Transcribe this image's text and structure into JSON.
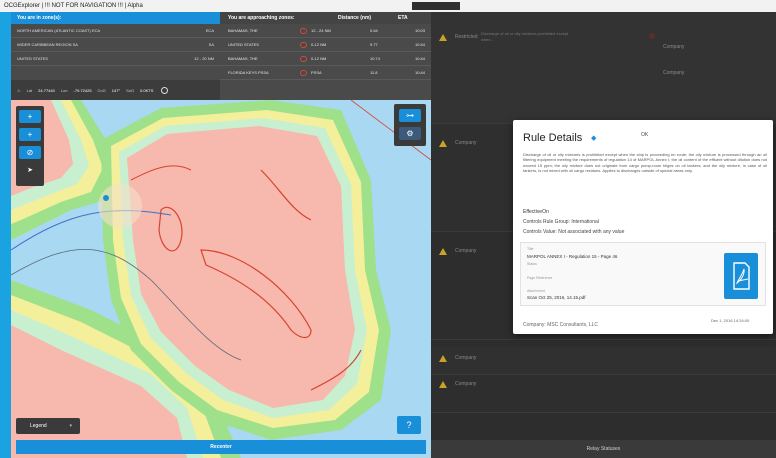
{
  "window": {
    "title": "OCGExplorer | !!! NOT FOR NAVIGATION !!! | Alpha"
  },
  "zones": {
    "header": "You are in zone(s):",
    "rows": [
      {
        "name": "NORTH AMERICAN (ATLANTIC COAST) ECA",
        "value": "ECA"
      },
      {
        "name": "WIDER CARIBBEAN REGION SA",
        "value": "SA"
      },
      {
        "name": "UNITED STATES",
        "value": "12 - 20 NM"
      }
    ]
  },
  "position_bar": {
    "lat_label": "Lat",
    "lat_value": "24.77440",
    "lon_label": "Lon",
    "lon_value": "-79.72425",
    "cog_label": "CoG",
    "cog_value": "147°",
    "sog_label": "SoG",
    "sog_value": "0.0KTS"
  },
  "approach": {
    "headers": [
      "You are approaching zones:",
      "",
      "Distance (nm)",
      "ETA"
    ],
    "rows": [
      {
        "name": "BAHAMAS, THE",
        "range": "12 - 24 NM",
        "distance": "0.64",
        "eta": "10:03"
      },
      {
        "name": "UNITED STATES",
        "range": "0-12 NM",
        "distance": "9.77",
        "eta": "10:44"
      },
      {
        "name": "BAHAMAS, THE",
        "range": "0-12 NM",
        "distance": "10.74",
        "eta": "10:44"
      },
      {
        "name": "FLORIDA KEYS PSSA",
        "range": "PSSA",
        "distance": "11.8",
        "eta": "10:44"
      }
    ]
  },
  "map_controls": {
    "zoom_in": "+",
    "zoom_out": "+",
    "compass": "⊘",
    "pointer": "➤",
    "legend_label": "Legend",
    "help_label": "?",
    "recenter_label": "Recenter"
  },
  "right_list": [
    {
      "label": "Restricted",
      "desc": "Discharge of oil or oily mixtures prohibited except when...",
      "company": "Company"
    },
    {
      "label": "",
      "desc": "",
      "company": "Company"
    },
    {
      "label": "Company",
      "desc": "",
      "company": ""
    },
    {
      "label": "Company",
      "desc": "",
      "company": ""
    },
    {
      "label": "Company",
      "desc": "",
      "company": ""
    },
    {
      "label": "Company",
      "desc": "",
      "company": ""
    }
  ],
  "relay": {
    "label": "Relay Statuses"
  },
  "rule": {
    "title": "Rule Details",
    "ok": "OK",
    "description": "Discharge of oil or oily mixtures is prohibited except when the ship is proceeding en route; the oily mixture is processed through an oil filtering equipment meeting the requirements of regulation 14 of MARPOL Annex I; the oil content of the effluent without dilution does not exceed 15 ppm; the oily mixture does not originate from cargo pump-room bilges on oil tankers; and the oily mixture, in case of oil tankers, is not mixed with oil cargo residues. Applies to discharges outside of special areas only.",
    "effective_on": "EffectiveOn",
    "group": "Controls Rule Group: International",
    "value": "Controls Value: Not associated with any value",
    "doc_title_label": "Title",
    "doc_title": "MARPOL ANNEX I - Regulation 15 - Page 46",
    "doc_status_label": "Status",
    "doc_page_label": "Page Reference",
    "doc_file_label": "Attachment",
    "doc_file": "Scan Oct 25, 2016, 14.15.pdf",
    "date": "Dec 1, 2016 14:34:00",
    "company": "Company: MSC Consultants, LLC"
  }
}
